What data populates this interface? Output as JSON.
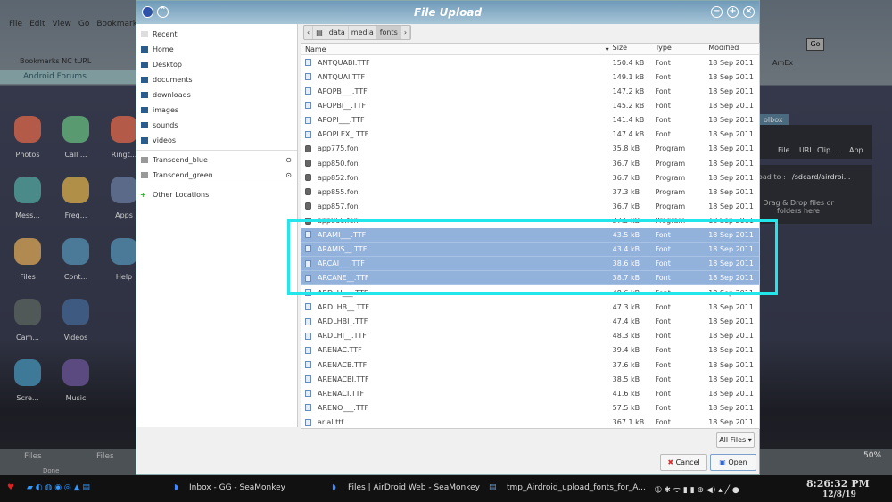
{
  "background": {
    "menu": [
      "File",
      "Edit",
      "View",
      "Go",
      "Bookmarks",
      "To"
    ],
    "bookmarks": "Bookmarks  NC  tURL",
    "tab": "Android Forums",
    "amex": "AmEx",
    "go": "Go",
    "apps": [
      "Photos",
      "Call ...",
      "Ringt...",
      "Mess...",
      "Freq...",
      "Apps",
      "Files",
      "Cont...",
      "Help",
      "Cam...",
      "Videos",
      "Scre...",
      "Music"
    ],
    "toolbox": "olbox",
    "tools": [
      "File",
      "URL",
      "Clip...",
      "App"
    ],
    "upload_to": "oad to :",
    "upload_path": "/sdcard/airdroi...",
    "dropzone": "Drag & Drop files or folders here",
    "tabs": [
      "Files",
      "Files"
    ],
    "status": "Done",
    "zoom": "50%"
  },
  "dialog": {
    "title": "File Upload",
    "sidebar": [
      "Recent",
      "Home",
      "Desktop",
      "documents",
      "downloads",
      "images",
      "sounds",
      "videos"
    ],
    "drives": [
      "Transcend_blue",
      "Transcend_green"
    ],
    "other": "Other Locations",
    "breadcrumb": [
      "data",
      "media",
      "fonts"
    ],
    "columns": [
      "Name",
      "Size",
      "Type",
      "Modified"
    ],
    "files": [
      {
        "name": "ANTQUABI.TTF",
        "size": "150.4 kB",
        "type": "Font",
        "modified": "18 Sep 2011"
      },
      {
        "name": "ANTQUAI.TTF",
        "size": "149.1 kB",
        "type": "Font",
        "modified": "18 Sep 2011"
      },
      {
        "name": "APOPB___.TTF",
        "size": "147.2 kB",
        "type": "Font",
        "modified": "18 Sep 2011"
      },
      {
        "name": "APOPBI__.TTF",
        "size": "145.2 kB",
        "type": "Font",
        "modified": "18 Sep 2011"
      },
      {
        "name": "APOPI___.TTF",
        "size": "141.4 kB",
        "type": "Font",
        "modified": "18 Sep 2011"
      },
      {
        "name": "APOPLEX_.TTF",
        "size": "147.4 kB",
        "type": "Font",
        "modified": "18 Sep 2011"
      },
      {
        "name": "app775.fon",
        "size": "35.8 kB",
        "type": "Program",
        "modified": "18 Sep 2011"
      },
      {
        "name": "app850.fon",
        "size": "36.7 kB",
        "type": "Program",
        "modified": "18 Sep 2011"
      },
      {
        "name": "app852.fon",
        "size": "36.7 kB",
        "type": "Program",
        "modified": "18 Sep 2011"
      },
      {
        "name": "app855.fon",
        "size": "37.3 kB",
        "type": "Program",
        "modified": "18 Sep 2011"
      },
      {
        "name": "app857.fon",
        "size": "36.7 kB",
        "type": "Program",
        "modified": "18 Sep 2011"
      },
      {
        "name": "app866.fon",
        "size": "37.5 kB",
        "type": "Program",
        "modified": "18 Sep 2011"
      },
      {
        "name": "ARAMI___.TTF",
        "size": "43.5 kB",
        "type": "Font",
        "modified": "18 Sep 2011",
        "selected": true
      },
      {
        "name": "ARAMIS__.TTF",
        "size": "43.4 kB",
        "type": "Font",
        "modified": "18 Sep 2011",
        "selected": true
      },
      {
        "name": "ARCAI___.TTF",
        "size": "38.6 kB",
        "type": "Font",
        "modified": "18 Sep 2011",
        "selected": true
      },
      {
        "name": "ARCANE__.TTF",
        "size": "38.7 kB",
        "type": "Font",
        "modified": "18 Sep 2011",
        "selected": true
      },
      {
        "name": "ARDLH___.TTF",
        "size": "48.6 kB",
        "type": "Font",
        "modified": "18 Sep 2011"
      },
      {
        "name": "ARDLHB__.TTF",
        "size": "47.3 kB",
        "type": "Font",
        "modified": "18 Sep 2011"
      },
      {
        "name": "ARDLHBI_.TTF",
        "size": "47.4 kB",
        "type": "Font",
        "modified": "18 Sep 2011"
      },
      {
        "name": "ARDLHI__.TTF",
        "size": "48.3 kB",
        "type": "Font",
        "modified": "18 Sep 2011"
      },
      {
        "name": "ARENAC.TTF",
        "size": "39.4 kB",
        "type": "Font",
        "modified": "18 Sep 2011"
      },
      {
        "name": "ARENACB.TTF",
        "size": "37.6 kB",
        "type": "Font",
        "modified": "18 Sep 2011"
      },
      {
        "name": "ARENACBI.TTF",
        "size": "38.5 kB",
        "type": "Font",
        "modified": "18 Sep 2011"
      },
      {
        "name": "ARENACI.TTF",
        "size": "41.6 kB",
        "type": "Font",
        "modified": "18 Sep 2011"
      },
      {
        "name": "ARENO___.TTF",
        "size": "57.5 kB",
        "type": "Font",
        "modified": "18 Sep 2011"
      },
      {
        "name": "arial.ttf",
        "size": "367.1 kB",
        "type": "Font",
        "modified": "18 Sep 2011"
      }
    ],
    "filter": "All Files",
    "cancel": "Cancel",
    "open": "Open"
  },
  "taskbar": {
    "items": [
      "Inbox - GG - SeaMonkey",
      "Files | AirDroid Web - SeaMonkey",
      "tmp_Airdroid_upload_fonts_for_A..."
    ],
    "time": "8:26:32 PM",
    "date": "12/8/19"
  },
  "colors": {
    "highlight": "#22e6ea",
    "selection": "#92b1db"
  }
}
